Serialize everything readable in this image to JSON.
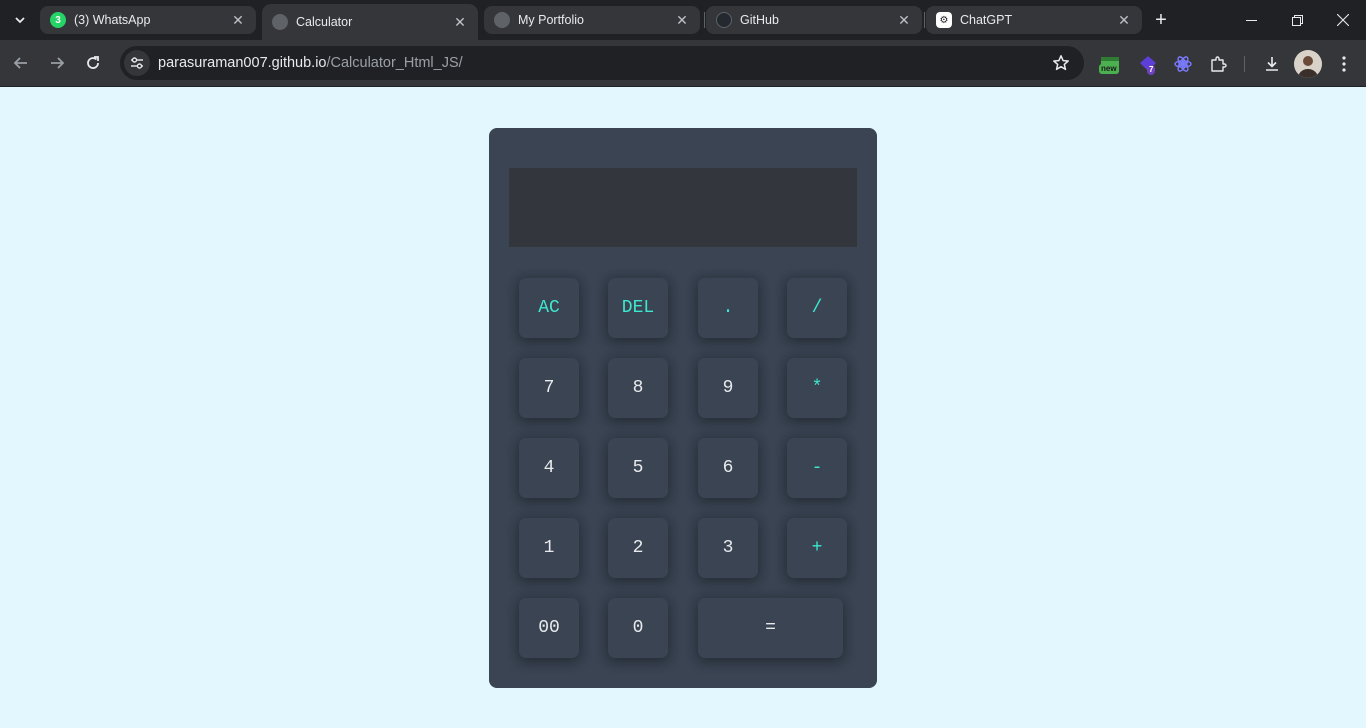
{
  "browser": {
    "tabs": [
      {
        "title": "(3) WhatsApp",
        "badge": "3",
        "active": false
      },
      {
        "title": "Calculator",
        "active": true
      },
      {
        "title": "My Portfolio",
        "active": false
      },
      {
        "title": "GitHub",
        "active": false
      },
      {
        "title": "ChatGPT",
        "active": false
      }
    ],
    "url_host": "parasuraman007.github.io",
    "url_path": "/Calculator_Html_JS/",
    "extensions": {
      "calendar_badge": "new",
      "gem_badge": "7"
    }
  },
  "calculator": {
    "display_value": "",
    "keys": {
      "ac": "AC",
      "del": "DEL",
      "dot": ".",
      "divide": "/",
      "seven": "7",
      "eight": "8",
      "nine": "9",
      "multiply": "*",
      "four": "4",
      "five": "5",
      "six": "6",
      "minus": "-",
      "one": "1",
      "two": "2",
      "three": "3",
      "plus": "+",
      "double_zero": "00",
      "zero": "0",
      "equals": "="
    }
  },
  "colors": {
    "page_bg": "#e3f7ff",
    "calc_body": "#3a4452",
    "display_bg": "#33363c",
    "operator_text": "#3ce8d0",
    "digit_text": "#e8eaed"
  }
}
